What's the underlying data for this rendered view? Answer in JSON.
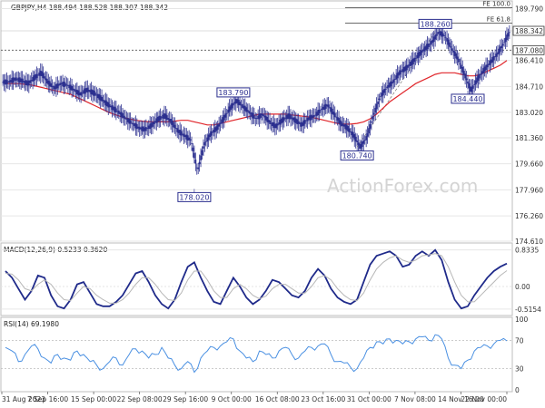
{
  "chart_data": [
    {
      "type": "candlestick",
      "title": "GBPJPY,H4  188.494 188.528 188.307 188.342",
      "symbol": "GBPJPY,H4",
      "ohlc_last": {
        "open": 188.494,
        "high": 188.528,
        "low": 188.307,
        "close": 188.342
      },
      "ylim": [
        174.61,
        190.0
      ],
      "y_ticks": [
        "189.790",
        "188.342",
        "187.080",
        "186.410",
        "184.710",
        "183.020",
        "181.360",
        "179.660",
        "177.960",
        "176.260",
        "174.610"
      ],
      "x_tick_labels": [
        "31 Aug 2023",
        "7 Sep 16:00",
        "15 Sep 00:00",
        "22 Sep 08:00",
        "29 Sep 16:00",
        "9 Oct 00:00",
        "16 Oct 08:00",
        "23 Oct 16:00",
        "31 Oct 00:00",
        "7 Nov 08:00",
        "14 Nov 16:00",
        "22 Nov 00:00"
      ],
      "close_path": [
        185.0,
        185.2,
        185.1,
        184.9,
        185.3,
        185.6,
        185.0,
        184.6,
        184.9,
        184.8,
        184.5,
        184.2,
        184.5,
        184.3,
        184.0,
        183.6,
        183.3,
        183.0,
        182.6,
        182.3,
        182.0,
        181.9,
        182.2,
        182.6,
        182.8,
        182.4,
        181.8,
        181.5,
        181.2,
        179.2,
        180.9,
        181.6,
        182.0,
        182.6,
        183.3,
        183.79,
        183.4,
        183.0,
        182.6,
        182.9,
        182.4,
        182.1,
        182.5,
        182.8,
        182.5,
        182.2,
        182.6,
        182.8,
        183.2,
        183.5,
        182.9,
        182.3,
        182.0,
        181.5,
        180.74,
        181.4,
        182.8,
        184.0,
        184.6,
        185.0,
        185.6,
        185.9,
        186.3,
        186.8,
        187.2,
        187.6,
        188.26,
        188.0,
        187.2,
        186.5,
        185.5,
        184.44,
        185.2,
        185.8,
        186.3,
        186.8,
        187.5,
        188.342
      ],
      "moving_average": [
        184.9,
        184.9,
        184.9,
        184.85,
        184.8,
        184.7,
        184.6,
        184.5,
        184.4,
        184.3,
        184.2,
        184.0,
        183.8,
        183.6,
        183.4,
        183.2,
        183.0,
        182.85,
        182.7,
        182.6,
        182.5,
        182.45,
        182.4,
        182.4,
        182.4,
        182.4,
        182.45,
        182.5,
        182.5,
        182.4,
        182.3,
        182.2,
        182.2,
        182.3,
        182.4,
        182.5,
        182.6,
        182.7,
        182.8,
        182.9,
        182.9,
        182.9,
        182.9,
        182.9,
        182.85,
        182.8,
        182.75,
        182.7,
        182.6,
        182.5,
        182.4,
        182.3,
        182.25,
        182.25,
        182.3,
        182.4,
        182.6,
        182.9,
        183.3,
        183.7,
        184.0,
        184.3,
        184.6,
        184.9,
        185.1,
        185.3,
        185.5,
        185.6,
        185.6,
        185.6,
        185.5,
        185.4,
        185.4,
        185.5,
        185.7,
        185.9,
        186.1,
        186.4
      ],
      "annotations": [
        {
          "label": "183.790",
          "x_index": 35,
          "value": 183.79,
          "side": "above"
        },
        {
          "label": "178.020",
          "x_index": 29,
          "value": 178.02,
          "side": "below"
        },
        {
          "label": "180.740",
          "x_index": 54,
          "value": 180.74,
          "side": "below"
        },
        {
          "label": "188.260",
          "x_index": 66,
          "value": 188.26,
          "side": "above"
        },
        {
          "label": "184.440",
          "x_index": 71,
          "value": 184.44,
          "side": "below"
        }
      ],
      "hlines": [
        {
          "label": "FE 100.0",
          "value": 189.85
        },
        {
          "label": "FE 61.8",
          "value": 188.85
        }
      ],
      "dotted_level": 187.08,
      "watermark": "ActionForex.com",
      "colors": {
        "candles": "#2b2f8f",
        "ma": "#e0262b",
        "last_price_bg": "#ffffff"
      }
    },
    {
      "type": "line",
      "title": "MACD(12,26,9) 0.5233 0.3620",
      "y_ticks": [
        "0.8335",
        "0.00",
        "-0.5154"
      ],
      "ylim": [
        -0.62,
        0.95
      ],
      "series": [
        {
          "name": "MACD",
          "values": [
            0.35,
            0.2,
            -0.05,
            -0.3,
            -0.1,
            0.25,
            0.2,
            -0.2,
            -0.45,
            -0.5,
            -0.3,
            0.05,
            0.1,
            -0.15,
            -0.4,
            -0.45,
            -0.45,
            -0.35,
            -0.2,
            0.05,
            0.3,
            0.35,
            0.1,
            -0.2,
            -0.4,
            -0.5,
            -0.3,
            0.1,
            0.45,
            0.55,
            0.2,
            -0.1,
            -0.35,
            -0.4,
            -0.1,
            0.2,
            0.0,
            -0.25,
            -0.4,
            -0.3,
            -0.1,
            0.15,
            0.1,
            -0.05,
            -0.2,
            -0.25,
            -0.1,
            0.2,
            0.4,
            0.25,
            -0.05,
            -0.25,
            -0.35,
            -0.4,
            -0.3,
            0.1,
            0.5,
            0.7,
            0.75,
            0.8,
            0.7,
            0.45,
            0.5,
            0.7,
            0.8,
            0.7,
            0.83,
            0.6,
            0.1,
            -0.3,
            -0.5,
            -0.45,
            -0.2,
            0.0,
            0.2,
            0.35,
            0.45,
            0.5233
          ],
          "color": "#1f2a8a"
        },
        {
          "name": "Signal",
          "values": [
            0.3,
            0.28,
            0.15,
            -0.05,
            -0.1,
            0.05,
            0.15,
            0.05,
            -0.15,
            -0.3,
            -0.32,
            -0.15,
            0.0,
            -0.05,
            -0.2,
            -0.3,
            -0.38,
            -0.38,
            -0.3,
            -0.15,
            0.05,
            0.2,
            0.2,
            0.05,
            -0.15,
            -0.3,
            -0.32,
            -0.15,
            0.15,
            0.35,
            0.35,
            0.15,
            -0.1,
            -0.25,
            -0.25,
            -0.05,
            0.05,
            -0.05,
            -0.2,
            -0.28,
            -0.22,
            -0.05,
            0.05,
            0.05,
            -0.05,
            -0.15,
            -0.15,
            0.0,
            0.2,
            0.25,
            0.15,
            -0.05,
            -0.2,
            -0.3,
            -0.32,
            -0.15,
            0.15,
            0.4,
            0.55,
            0.65,
            0.7,
            0.6,
            0.55,
            0.6,
            0.7,
            0.72,
            0.75,
            0.7,
            0.45,
            0.1,
            -0.2,
            -0.35,
            -0.35,
            -0.2,
            -0.05,
            0.1,
            0.25,
            0.362
          ],
          "color": "#b7b7b7"
        }
      ]
    },
    {
      "type": "line",
      "title": "RSI(14) 69.1980",
      "y_ticks": [
        "100",
        "70",
        "30",
        "0"
      ],
      "ylim": [
        0,
        100
      ],
      "series": [
        {
          "name": "RSI",
          "values": [
            60,
            55,
            40,
            50,
            62,
            58,
            45,
            38,
            50,
            45,
            42,
            55,
            50,
            40,
            35,
            30,
            40,
            45,
            35,
            50,
            58,
            55,
            45,
            50,
            60,
            45,
            35,
            30,
            40,
            25,
            45,
            55,
            60,
            62,
            68,
            72,
            55,
            45,
            40,
            55,
            50,
            45,
            55,
            60,
            50,
            45,
            55,
            60,
            62,
            65,
            50,
            40,
            38,
            32,
            30,
            45,
            60,
            68,
            65,
            72,
            70,
            65,
            68,
            72,
            75,
            70,
            78,
            72,
            45,
            35,
            30,
            42,
            55,
            60,
            62,
            65,
            70,
            69.198
          ],
          "color": "#4a90e2"
        }
      ]
    }
  ]
}
